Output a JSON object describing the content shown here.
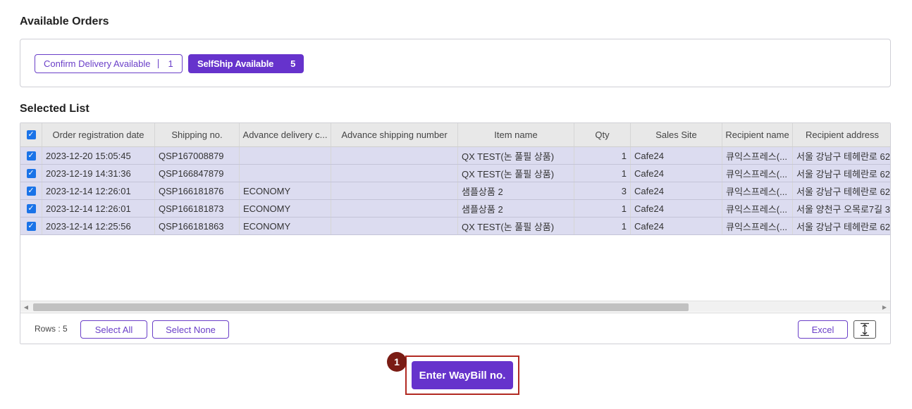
{
  "available_orders": {
    "title": "Available Orders",
    "filters": [
      {
        "label": "Confirm Delivery Available",
        "count": "1",
        "active": false
      },
      {
        "label": "SelfShip Available",
        "count": "5",
        "active": true
      }
    ]
  },
  "selected_list": {
    "title": "Selected List",
    "columns": [
      "Order registration date",
      "Shipping no.",
      "Advance delivery c...",
      "Advance shipping number",
      "Item name",
      "Qty",
      "Sales Site",
      "Recipient name",
      "Recipient address"
    ],
    "rows": [
      {
        "date": "2023-12-20 15:05:45",
        "shipping_no": "QSP167008879",
        "adv_delivery": "",
        "adv_shipping_no": "",
        "item": "QX TEST(논 풀필 상품)",
        "qty": "1",
        "site": "Cafe24",
        "recipient_name": "큐익스프레스(...",
        "recipient_address": "서울 강남구 테헤란로 62"
      },
      {
        "date": "2023-12-19 14:31:36",
        "shipping_no": "QSP166847879",
        "adv_delivery": "",
        "adv_shipping_no": "",
        "item": "QX TEST(논 풀필 상품)",
        "qty": "1",
        "site": "Cafe24",
        "recipient_name": "큐익스프레스(...",
        "recipient_address": "서울 강남구 테헤란로 62"
      },
      {
        "date": "2023-12-14 12:26:01",
        "shipping_no": "QSP166181876",
        "adv_delivery": "ECONOMY",
        "adv_shipping_no": "",
        "item": "샘플상품 2",
        "qty": "3",
        "site": "Cafe24",
        "recipient_name": "큐익스프레스(...",
        "recipient_address": "서울 강남구 테헤란로 62"
      },
      {
        "date": "2023-12-14 12:26:01",
        "shipping_no": "QSP166181873",
        "adv_delivery": "ECONOMY",
        "adv_shipping_no": "",
        "item": "샘플상품 2",
        "qty": "1",
        "site": "Cafe24",
        "recipient_name": "큐익스프레스(...",
        "recipient_address": "서울 양천구 오목로7길 3"
      },
      {
        "date": "2023-12-14 12:25:56",
        "shipping_no": "QSP166181863",
        "adv_delivery": "ECONOMY",
        "adv_shipping_no": "",
        "item": "QX TEST(논 풀필 상품)",
        "qty": "1",
        "site": "Cafe24",
        "recipient_name": "큐익스프레스(...",
        "recipient_address": "서울 강남구 테헤란로 62"
      }
    ],
    "footer": {
      "rows_label": "Rows : 5",
      "select_all": "Select All",
      "select_none": "Select None",
      "excel": "Excel"
    }
  },
  "action": {
    "step_number": "1",
    "enter_waybill_label": "Enter WayBill no."
  },
  "colors": {
    "accent": "#6633cc",
    "highlight": "#b22a22",
    "row_selected": "#dcdcf0"
  },
  "icons": {
    "checkbox": "checkbox-checked-icon",
    "resize": "vertical-resize-icon",
    "scroll_left": "chevron-left-icon",
    "scroll_right": "chevron-right-icon"
  }
}
